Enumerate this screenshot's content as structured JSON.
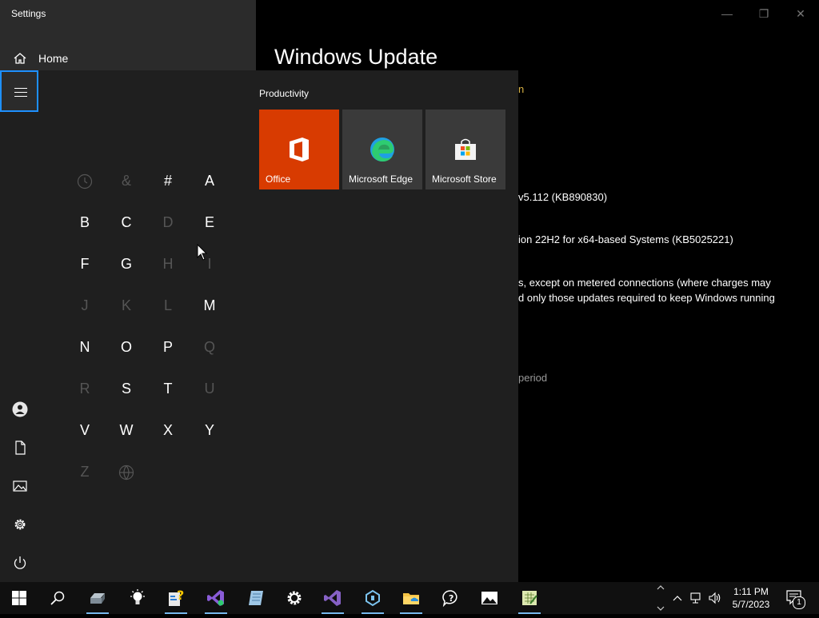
{
  "window": {
    "title": "Settings",
    "home_label": "Home",
    "page_title": "Windows Update",
    "minimize": "—",
    "restore": "❐",
    "close": "✕"
  },
  "background_clips": {
    "n": "n",
    "kb890830": "v5.112 (KB890830)",
    "kb5025221": "ion 22H2 for x64-based Systems (KB5025221)",
    "metered1": "s, except on metered connections (where charges may",
    "metered2": "d only those updates required to keep Windows running",
    "period": "period"
  },
  "start_menu": {
    "group_label": "Productivity",
    "tiles": [
      {
        "label": "Office",
        "color": "#d83b01"
      },
      {
        "label": "Microsoft Edge",
        "color": "#3a3a3a"
      },
      {
        "label": "Microsoft Store",
        "color": "#3a3a3a"
      }
    ],
    "letters": [
      {
        "text": "",
        "enabled": false,
        "icon": "clock-icon"
      },
      {
        "text": "&",
        "enabled": false
      },
      {
        "text": "#",
        "enabled": true
      },
      {
        "text": "A",
        "enabled": true
      },
      {
        "text": "B",
        "enabled": true
      },
      {
        "text": "C",
        "enabled": true
      },
      {
        "text": "D",
        "enabled": false
      },
      {
        "text": "E",
        "enabled": true
      },
      {
        "text": "F",
        "enabled": true
      },
      {
        "text": "G",
        "enabled": true
      },
      {
        "text": "H",
        "enabled": false
      },
      {
        "text": "I",
        "enabled": false
      },
      {
        "text": "J",
        "enabled": false
      },
      {
        "text": "K",
        "enabled": false
      },
      {
        "text": "L",
        "enabled": false
      },
      {
        "text": "M",
        "enabled": true
      },
      {
        "text": "N",
        "enabled": true
      },
      {
        "text": "O",
        "enabled": true
      },
      {
        "text": "P",
        "enabled": true
      },
      {
        "text": "Q",
        "enabled": false
      },
      {
        "text": "R",
        "enabled": false
      },
      {
        "text": "S",
        "enabled": true
      },
      {
        "text": "T",
        "enabled": true
      },
      {
        "text": "U",
        "enabled": false
      },
      {
        "text": "V",
        "enabled": true
      },
      {
        "text": "W",
        "enabled": true
      },
      {
        "text": "X",
        "enabled": true
      },
      {
        "text": "Y",
        "enabled": true
      },
      {
        "text": "Z",
        "enabled": false
      },
      {
        "text": "",
        "enabled": false,
        "icon": "globe-icon"
      }
    ],
    "rail_icons": [
      "user-icon",
      "document-icon",
      "pictures-icon",
      "settings-gear-icon",
      "power-icon"
    ]
  },
  "taskbar": {
    "time": "1:11 PM",
    "date": "5/7/2023",
    "notification_count": "1",
    "apps": [
      "start-icon",
      "search-icon",
      "printer-app-icon",
      "tips-bulb-icon",
      "help-app-icon",
      "visual-studio-installer-icon",
      "notepad-app-icon",
      "settings-gear-icon",
      "visual-studio-icon",
      "dev-tool-icon",
      "file-explorer-icon",
      "get-help-icon",
      "photos-icon",
      "excel-editor-icon"
    ],
    "accent": "#77b9ee"
  }
}
